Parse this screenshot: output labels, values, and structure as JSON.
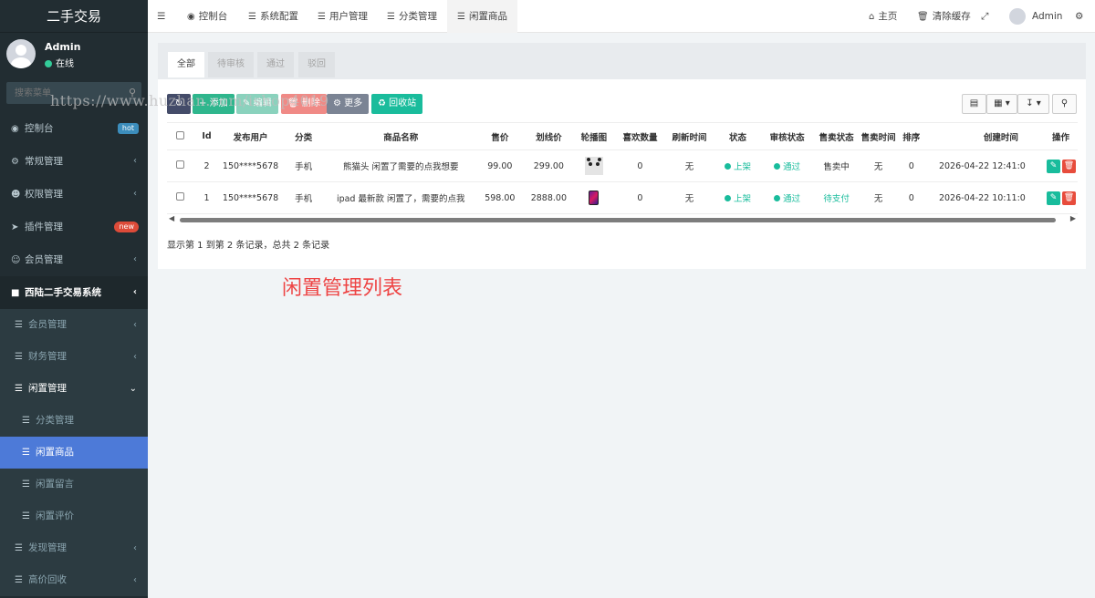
{
  "sidebar": {
    "brand": "二手交易",
    "user": {
      "name": "Admin",
      "status": "在线"
    },
    "search_placeholder": "搜索菜单",
    "items": [
      {
        "label": "控制台",
        "badge": "hot"
      },
      {
        "label": "常规管理"
      },
      {
        "label": "权限管理"
      },
      {
        "label": "插件管理",
        "badge": "new"
      },
      {
        "label": "会员管理"
      },
      {
        "label": "西陆二手交易系统"
      },
      {
        "label": "会员管理"
      },
      {
        "label": "财务管理"
      },
      {
        "label": "闲置管理"
      },
      {
        "label": "分类管理"
      },
      {
        "label": "闲置商品"
      },
      {
        "label": "闲置留言"
      },
      {
        "label": "闲置评价"
      },
      {
        "label": "发现管理"
      },
      {
        "label": "高价回收"
      }
    ]
  },
  "topbar": {
    "tabs": [
      "控制台",
      "系统配置",
      "用户管理",
      "分类管理",
      "闲置商品"
    ],
    "home": "主页",
    "clear_cache": "清除缓存",
    "admin": "Admin"
  },
  "filter_tabs": [
    "全部",
    "待审核",
    "通过",
    "驳回"
  ],
  "toolbar": {
    "add": "添加",
    "edit": "编辑",
    "delete": "删除",
    "more": "更多",
    "recycle": "回收站"
  },
  "table": {
    "headers": [
      "Id",
      "发布用户",
      "分类",
      "商品名称",
      "售价",
      "划线价",
      "轮播图",
      "喜欢数量",
      "刷新时间",
      "状态",
      "审核状态",
      "售卖状态",
      "售卖时间",
      "排序",
      "创建时间",
      "操作"
    ],
    "rows": [
      {
        "id": "2",
        "user": "150****5678",
        "category": "手机",
        "name": "熊猫头 闲置了需要的点我想要",
        "price": "99.00",
        "orig_price": "299.00",
        "likes": "0",
        "refresh": "无",
        "status": "上架",
        "audit": "通过",
        "sale_status": "售卖中",
        "sale_time": "无",
        "sort": "0",
        "created": "2026-04-22 12:41:0"
      },
      {
        "id": "1",
        "user": "150****5678",
        "category": "手机",
        "name": "ipad 最新款 闲置了，需要的点我",
        "price": "598.00",
        "orig_price": "2888.00",
        "likes": "0",
        "refresh": "无",
        "status": "上架",
        "audit": "通过",
        "sale_status": "待支付",
        "sale_time": "无",
        "sort": "0",
        "created": "2026-04-22 10:11:0"
      }
    ]
  },
  "pager_info": "显示第 1 到第 2 条记录，总共 2 条记录",
  "caption": "闲置管理列表",
  "watermark": "https://www.huzhan.com/ishop4019"
}
